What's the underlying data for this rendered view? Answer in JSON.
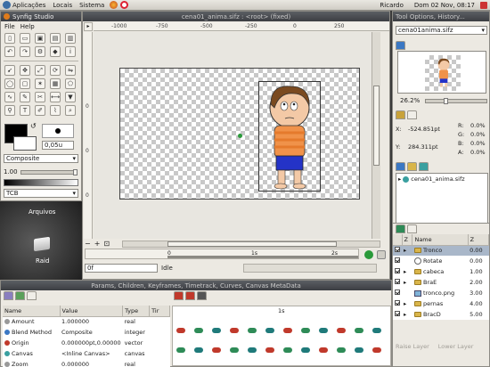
{
  "top_panel": {
    "menus": [
      "Aplicações",
      "Locais",
      "Sistema"
    ],
    "user": "Ricardo",
    "datetime": "Dom 02 Nov, 08:17"
  },
  "desktop": {
    "arquivos_label": "Arquivos",
    "raid_label": "Raid"
  },
  "toolbox": {
    "title": "Synfig Studio",
    "menu": [
      "File",
      "Help"
    ],
    "width_value": "0,05u",
    "blend_method": "Composite",
    "amount_value": "1.00",
    "interp_value": "TCB"
  },
  "canvas_window": {
    "title": "cena01_anima.sifz : <root> (fixed)",
    "ruler_labels": [
      "-1000",
      "-750",
      "-500",
      "-250",
      "0",
      "250"
    ],
    "vruler_labels": [
      "0",
      "0",
      "0"
    ],
    "timebar_labels": [
      "0",
      "1s",
      "2s"
    ],
    "time_field": "0f",
    "status": "Idle"
  },
  "tool_options": {
    "title": "Tool Options, History...",
    "file_select": "cena01anima.sifz",
    "zoom_percent": "26.2%",
    "x_label": "X:",
    "x_value": "-524.851pt",
    "y_label": "Y:",
    "y_value": "284.311pt",
    "r_label": "R:",
    "r_value": "0.0%",
    "g_label": "G:",
    "g_value": "0.0%",
    "b_label": "B:",
    "b_value": "0.0%",
    "a_label": "A:",
    "a_value": "0.0%",
    "canvas_tree_item": "cena01_anima.sifz"
  },
  "layers": {
    "headers": [
      "Z",
      "Name",
      "Z"
    ],
    "rows": [
      {
        "name": "Tronco",
        "z": "0.00",
        "icon": "folder",
        "selected": true
      },
      {
        "name": "Rotate",
        "z": "0.00",
        "icon": "rotate",
        "selected": false
      },
      {
        "name": "cabeca",
        "z": "1.00",
        "icon": "folder",
        "selected": false
      },
      {
        "name": "BraE",
        "z": "2.00",
        "icon": "folder",
        "selected": false
      },
      {
        "name": "tronco.png",
        "z": "3.00",
        "icon": "image",
        "selected": false
      },
      {
        "name": "pernas",
        "z": "4.00",
        "icon": "folder",
        "selected": false
      },
      {
        "name": "BracD",
        "z": "5.00",
        "icon": "folder",
        "selected": false
      }
    ],
    "raise_label": "Raise Layer",
    "lower_label": "Lower Layer"
  },
  "params": {
    "title": "Params, Children, Keyframes, Timetrack, Curves, Canvas MetaData",
    "headers": [
      "Name",
      "Value",
      "Type",
      "Tir"
    ],
    "rows": [
      {
        "name": "Amount",
        "value": "1.000000",
        "type": "real"
      },
      {
        "name": "Blend Method",
        "value": "Composite",
        "type": "integer"
      },
      {
        "name": "Origin",
        "value": "0.000000pt,0.00000",
        "type": "vector"
      },
      {
        "name": "Canvas",
        "value": "<Inline Canvas>",
        "type": "canvas"
      },
      {
        "name": "Zoom",
        "value": "0.000000",
        "type": "real"
      }
    ],
    "timetrack_label": "1s"
  },
  "colors": {
    "panel_bg": "#ece9e2",
    "title_bg": "#4a4c50",
    "selection": "#a9b7c9",
    "waypoint_red": "#c0392b",
    "waypoint_green": "#2e8b57",
    "waypoint_teal": "#1f7a7a"
  }
}
